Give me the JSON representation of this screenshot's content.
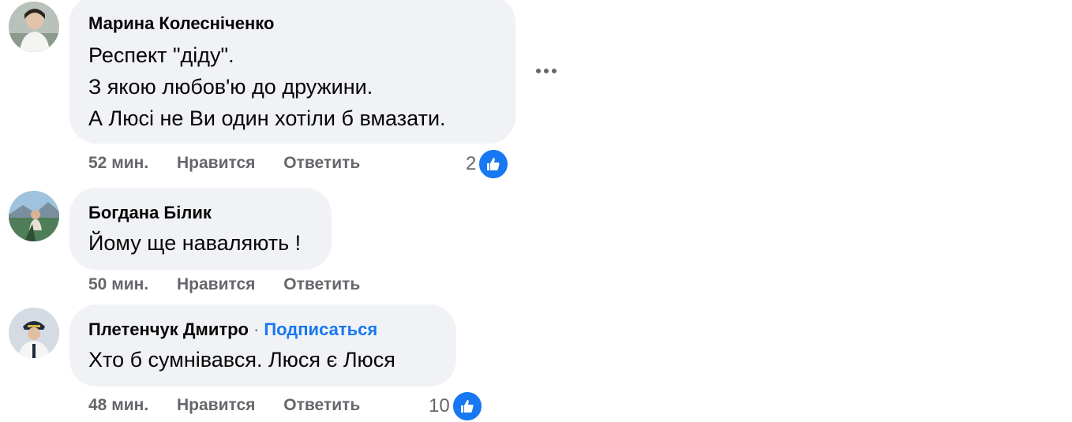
{
  "comments": [
    {
      "author": "Марина Колесніченко",
      "lines": [
        "Респект \"діду\".",
        "З якою любов'ю до дружини.",
        "А Люсі не Ви один хотіли б вмазати."
      ],
      "time": "52 мин.",
      "like_label": "Нравится",
      "reply_label": "Ответить",
      "reaction_count": "2"
    },
    {
      "author": "Богдана Білик",
      "lines": [
        "Йому ще наваляють !"
      ],
      "time": "50 мин.",
      "like_label": "Нравится",
      "reply_label": "Ответить"
    },
    {
      "author": "Плетенчук Дмитро",
      "separator": "·",
      "follow_label": "Подписаться",
      "lines": [
        "Хто б сумнівався. Люся є Люся"
      ],
      "time": "48 мин.",
      "like_label": "Нравится",
      "reply_label": "Ответить",
      "reaction_count": "10"
    }
  ],
  "icons": {
    "more": "more-options-icon",
    "like": "thumbs-up-icon"
  },
  "colors": {
    "bubble": "#f0f2f5",
    "accent": "#1877f2",
    "meta": "#65676b"
  }
}
